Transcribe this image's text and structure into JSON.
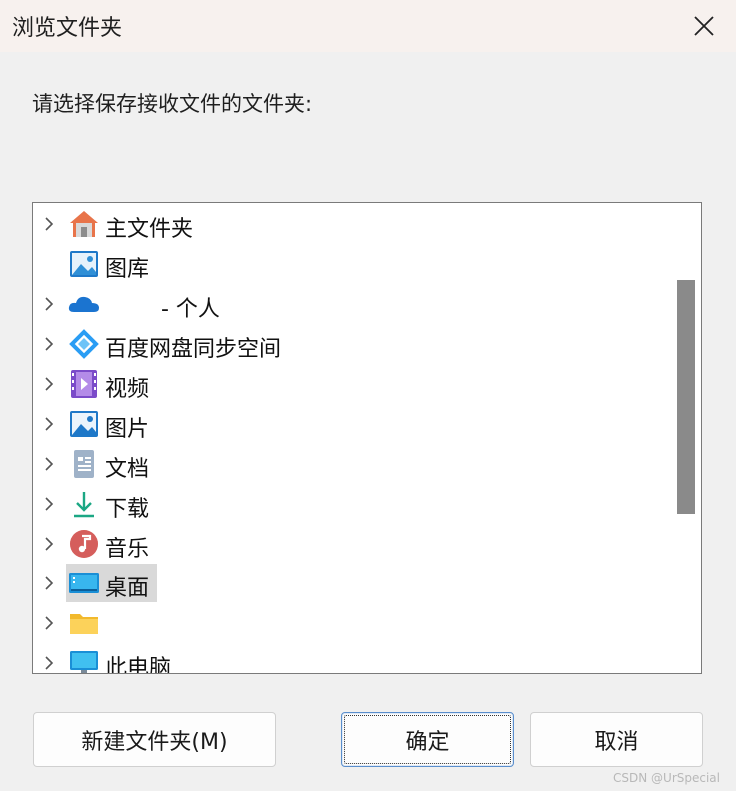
{
  "window": {
    "title": "浏览文件夹",
    "close_icon": "close-icon"
  },
  "prompt": "请选择保存接收文件的文件夹:",
  "tree": {
    "items": [
      {
        "label": "主文件夹",
        "icon": "home-icon",
        "expandable": true
      },
      {
        "label": "图库",
        "icon": "gallery-icon",
        "expandable": false
      },
      {
        "label": "- 个人",
        "icon": "onedrive-cloud-icon",
        "expandable": true
      },
      {
        "label": "百度网盘同步空间",
        "icon": "baidu-netdisk-icon",
        "expandable": true
      },
      {
        "label": "视频",
        "icon": "videos-icon",
        "expandable": true
      },
      {
        "label": "图片",
        "icon": "pictures-icon",
        "expandable": true
      },
      {
        "label": "文档",
        "icon": "documents-icon",
        "expandable": true
      },
      {
        "label": "下载",
        "icon": "downloads-icon",
        "expandable": true
      },
      {
        "label": "音乐",
        "icon": "music-icon",
        "expandable": true
      },
      {
        "label": "桌面",
        "icon": "desktop-icon",
        "expandable": true,
        "selected": true
      },
      {
        "label": "",
        "icon": "folder-icon",
        "expandable": true
      },
      {
        "label": "此电脑",
        "icon": "this-pc-icon",
        "expandable": true
      }
    ]
  },
  "buttons": {
    "new_folder": "新建文件夹(M)",
    "ok": "确定",
    "cancel": "取消"
  },
  "watermark": "CSDN @UrSpecial"
}
